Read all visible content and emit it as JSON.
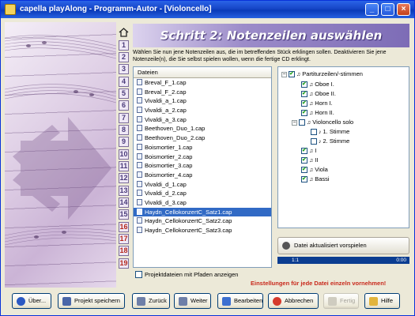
{
  "window": {
    "title": "capella playAlong - Programm-Autor - [Violoncello]",
    "controls": [
      "_",
      "□",
      "×"
    ]
  },
  "steps": {
    "home_icon": "home-icon",
    "numbers": [
      "1",
      "2",
      "3",
      "4",
      "5",
      "6",
      "7",
      "8",
      "9",
      "10",
      "11",
      "12",
      "13",
      "14",
      "15",
      "16",
      "17",
      "18",
      "19"
    ]
  },
  "heading": "Schritt 2: Notenzeilen auswählen",
  "description": "Wählen Sie nun jene Notenzeilen aus, die im betreffenden Stück erklingen sollen. Deaktivieren Sie jene Notenzeile(n), die Sie selbst spielen wollen, wenn die fertige CD erklingt.",
  "files": {
    "header": "Dateien",
    "items": [
      "Breval_F_1.cap",
      "Breval_F_2.cap",
      "Vivaldi_a_1.cap",
      "Vivaldi_a_2.cap",
      "Vivaldi_a_3.cap",
      "Beethoven_Duo_1.cap",
      "Beethoven_Duo_2.cap",
      "Boismortier_1.cap",
      "Boismortier_2.cap",
      "Boismortier_3.cap",
      "Boismortier_4.cap",
      "Vivaldi_d_1.cap",
      "Vivaldi_d_2.cap",
      "Vivaldi_d_3.cap",
      "Haydn_CellokonzertC_Satz1.cap",
      "Haydn_CellokonzertC_Satz2.cap",
      "Haydn_CellokonzertC_Satz3.cap"
    ],
    "selected_index": 14,
    "show_paths_label": "Projektdateien mit Pfaden anzeigen"
  },
  "tree": {
    "root": "Partiturzeilen/-stimmen",
    "items": [
      "Oboe I.",
      "Oboe II.",
      "Horn I.",
      "Horn II.",
      "Violoncello solo",
      "1. Stimme",
      "2. Stimme",
      "I",
      "II",
      "Viola",
      "Bassi"
    ]
  },
  "preview": {
    "label": "Datei aktualisiert vorspielen",
    "position": "1:1",
    "time": "0:00"
  },
  "warning": "Einstellungen für jede Datei einzeln vornehmen!",
  "buttons": {
    "about": "Über...",
    "save_project": "Projekt speichern",
    "back": "Zurück",
    "next": "Weiter",
    "edit": "Bearbeiten",
    "cancel": "Abbrechen",
    "done": "Fertig",
    "help": "Hilfe"
  },
  "colors": {
    "titlebar": "#1646c7",
    "heading": "#7d6cb6",
    "selection": "#316ac5",
    "warning": "#c8281b"
  }
}
